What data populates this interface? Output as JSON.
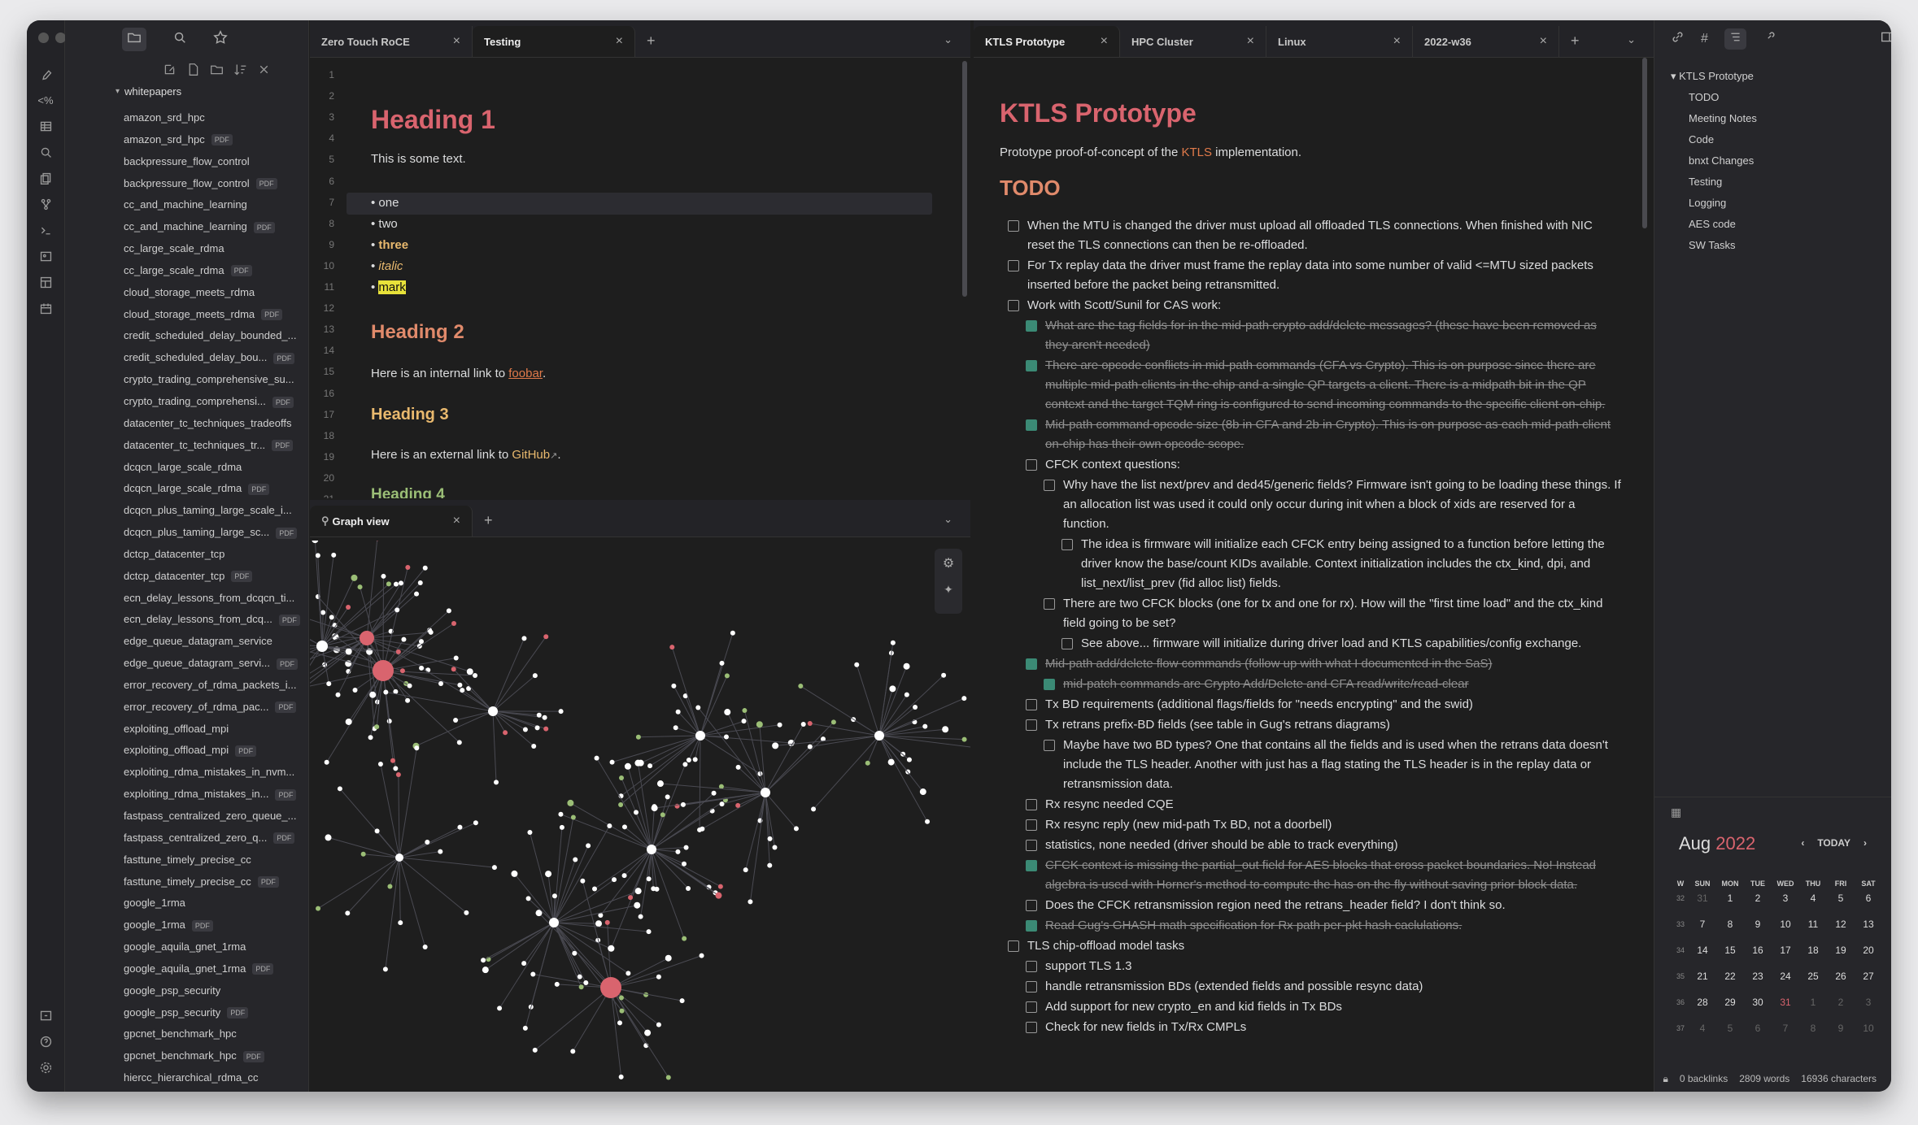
{
  "sidebar": {
    "folder": "whitepapers",
    "files": [
      {
        "n": "amazon_srd_hpc",
        "pdf": false
      },
      {
        "n": "amazon_srd_hpc",
        "pdf": true
      },
      {
        "n": "backpressure_flow_control",
        "pdf": false
      },
      {
        "n": "backpressure_flow_control",
        "pdf": true
      },
      {
        "n": "cc_and_machine_learning",
        "pdf": false
      },
      {
        "n": "cc_and_machine_learning",
        "pdf": true
      },
      {
        "n": "cc_large_scale_rdma",
        "pdf": false
      },
      {
        "n": "cc_large_scale_rdma",
        "pdf": true
      },
      {
        "n": "cloud_storage_meets_rdma",
        "pdf": false
      },
      {
        "n": "cloud_storage_meets_rdma",
        "pdf": true
      },
      {
        "n": "credit_scheduled_delay_bounded_...",
        "pdf": false
      },
      {
        "n": "credit_scheduled_delay_bou...",
        "pdf": true
      },
      {
        "n": "crypto_trading_comprehensive_su...",
        "pdf": false
      },
      {
        "n": "crypto_trading_comprehensi...",
        "pdf": true
      },
      {
        "n": "datacenter_tc_techniques_tradeoffs",
        "pdf": false
      },
      {
        "n": "datacenter_tc_techniques_tr...",
        "pdf": true
      },
      {
        "n": "dcqcn_large_scale_rdma",
        "pdf": false
      },
      {
        "n": "dcqcn_large_scale_rdma",
        "pdf": true
      },
      {
        "n": "dcqcn_plus_taming_large_scale_i...",
        "pdf": false
      },
      {
        "n": "dcqcn_plus_taming_large_sc...",
        "pdf": true
      },
      {
        "n": "dctcp_datacenter_tcp",
        "pdf": false
      },
      {
        "n": "dctcp_datacenter_tcp",
        "pdf": true
      },
      {
        "n": "ecn_delay_lessons_from_dcqcn_ti...",
        "pdf": false
      },
      {
        "n": "ecn_delay_lessons_from_dcq...",
        "pdf": true
      },
      {
        "n": "edge_queue_datagram_service",
        "pdf": false
      },
      {
        "n": "edge_queue_datagram_servi...",
        "pdf": true
      },
      {
        "n": "error_recovery_of_rdma_packets_i...",
        "pdf": false
      },
      {
        "n": "error_recovery_of_rdma_pac...",
        "pdf": true
      },
      {
        "n": "exploiting_offload_mpi",
        "pdf": false
      },
      {
        "n": "exploiting_offload_mpi",
        "pdf": true
      },
      {
        "n": "exploiting_rdma_mistakes_in_nvm...",
        "pdf": false
      },
      {
        "n": "exploiting_rdma_mistakes_in...",
        "pdf": true
      },
      {
        "n": "fastpass_centralized_zero_queue_...",
        "pdf": false
      },
      {
        "n": "fastpass_centralized_zero_q...",
        "pdf": true
      },
      {
        "n": "fasttune_timely_precise_cc",
        "pdf": false
      },
      {
        "n": "fasttune_timely_precise_cc",
        "pdf": true
      },
      {
        "n": "google_1rma",
        "pdf": false
      },
      {
        "n": "google_1rma",
        "pdf": true
      },
      {
        "n": "google_aquila_gnet_1rma",
        "pdf": false
      },
      {
        "n": "google_aquila_gnet_1rma",
        "pdf": true
      },
      {
        "n": "google_psp_security",
        "pdf": false
      },
      {
        "n": "google_psp_security",
        "pdf": true
      },
      {
        "n": "gpcnet_benchmark_hpc",
        "pdf": false
      },
      {
        "n": "gpcnet_benchmark_hpc",
        "pdf": true
      },
      {
        "n": "hiercc_hierarchical_rdma_cc",
        "pdf": false
      }
    ],
    "pdf_badge": "PDF"
  },
  "left_tabs": [
    {
      "label": "Zero Touch RoCE",
      "active": false
    },
    {
      "label": "Testing",
      "active": true
    }
  ],
  "right_tabs": [
    {
      "label": "KTLS Prototype",
      "active": true
    },
    {
      "label": "HPC Cluster",
      "active": false
    },
    {
      "label": "Linux",
      "active": false
    },
    {
      "label": "2022-w36",
      "active": false
    }
  ],
  "graph_tab": "Graph view",
  "editor": {
    "h1": "Heading 1",
    "text1": "This is some text.",
    "b1": "one",
    "b2": "two",
    "b3": "three",
    "b4": "italic",
    "b5": "mark",
    "h2": "Heading 2",
    "int_pre": "Here is an internal link to ",
    "int_link": "foobar",
    "int_post": ".",
    "h3": "Heading 3",
    "ext_pre": "Here is an external link to ",
    "ext_link": "GitHub",
    "ext_post": ".",
    "h4": "Heading 4"
  },
  "reading": {
    "title": "KTLS Prototype",
    "sub_pre": "Prototype proof-of-concept of the ",
    "sub_link": "KTLS",
    "sub_post": " implementation.",
    "todo": "TODO",
    "tasks": [
      {
        "d": 0,
        "done": false,
        "t": "When the MTU is changed the driver must upload all offloaded TLS connections. When finished with NIC reset the TLS connections can then be re-offloaded."
      },
      {
        "d": 0,
        "done": false,
        "t": "For Tx replay data the driver must frame the replay data into some number of valid <=MTU sized packets inserted before the packet being retransmitted."
      },
      {
        "d": 0,
        "done": false,
        "t": "Work with Scott/Sunil for CAS work:"
      },
      {
        "d": 1,
        "done": true,
        "t": "What are the tag fields for in the mid-path crypto add/delete messages? (these have been removed as they aren't needed)"
      },
      {
        "d": 1,
        "done": true,
        "t": "There are opcode conflicts in mid-path commands (CFA vs Crypto). This is on purpose since there are multiple mid-path clients in the chip and a single QP targets a client. There is a midpath bit in the QP context and the target TQM ring is configured to send incoming commands to the specific client on-chip."
      },
      {
        "d": 1,
        "done": true,
        "t": "Mid-path command opcode size (8b in CFA and 2b in Crypto). This is on purpose as each mid-path client on-chip has their own opcode scope."
      },
      {
        "d": 1,
        "done": false,
        "t": "CFCK context questions:"
      },
      {
        "d": 2,
        "done": false,
        "t": "Why have the list next/prev and ded45/generic fields? Firmware isn't going to be loading these things. If an allocation list was used it could only occur during init when a block of xids are reserved for a function."
      },
      {
        "d": 3,
        "done": false,
        "t": "The idea is firmware will initialize each CFCK entry being assigned to a function before letting the driver know the base/count KIDs available. Context initialization includes the ctx_kind, dpi, and list_next/list_prev (fid alloc list) fields."
      },
      {
        "d": 2,
        "done": false,
        "t": "There are two CFCK blocks (one for tx and one for rx). How will the \"first time load\" and the ctx_kind field going to be set?"
      },
      {
        "d": 3,
        "done": false,
        "t": "See above... firmware will initialize during driver load and KTLS capabilities/config exchange."
      },
      {
        "d": 1,
        "done": true,
        "t": "Mid-path add/delete flow commands (follow up with what I documented in the SaS)"
      },
      {
        "d": 2,
        "done": true,
        "t": "mid-patch commands are Crypto Add/Delete and CFA read/write/read-clear"
      },
      {
        "d": 1,
        "done": false,
        "t": "Tx BD requirements (additional flags/fields for \"needs encrypting\" and the swid)"
      },
      {
        "d": 1,
        "done": false,
        "t": "Tx retrans prefix-BD fields (see table in Gug's retrans diagrams)"
      },
      {
        "d": 2,
        "done": false,
        "t": "Maybe have two BD types? One that contains all the fields and is used when the retrans data doesn't include the TLS header. Another with just has a flag stating the TLS header is in the replay data or retransmission data."
      },
      {
        "d": 1,
        "done": false,
        "t": "Rx resync needed CQE"
      },
      {
        "d": 1,
        "done": false,
        "t": "Rx resync reply (new mid-path Tx BD, not a doorbell)"
      },
      {
        "d": 1,
        "done": false,
        "t": "statistics, none needed (driver should be able to track everything)"
      },
      {
        "d": 1,
        "done": true,
        "t": "CFCK context is missing the partial_out field for AES blocks that cross packet boundaries. No! Instead algebra is used with Horner's method to compute the has on the fly without saving prior block data."
      },
      {
        "d": 1,
        "done": false,
        "t": "Does the CFCK retransmission region need the retrans_header field? I don't think so."
      },
      {
        "d": 1,
        "done": true,
        "t": "Read Gug's GHASH math specification for Rx path per-pkt hash caclulations."
      },
      {
        "d": 0,
        "done": false,
        "t": "TLS chip-offload model tasks"
      },
      {
        "d": 1,
        "done": false,
        "t": "support TLS 1.3"
      },
      {
        "d": 1,
        "done": false,
        "t": "handle retransmission BDs (extended fields and possible resync data)"
      },
      {
        "d": 1,
        "done": false,
        "t": "Add support for new crypto_en and kid fields in Tx BDs"
      },
      {
        "d": 1,
        "done": false,
        "t": "Check for new fields in Tx/Rx CMPLs"
      }
    ]
  },
  "outline": [
    "KTLS Prototype",
    "TODO",
    "Meeting Notes",
    "Code",
    "bnxt Changes",
    "Testing",
    "Logging",
    "AES code",
    "SW Tasks"
  ],
  "calendar": {
    "month": "Aug",
    "year": "2022",
    "today_label": "TODAY",
    "headers": [
      "W",
      "SUN",
      "MON",
      "TUE",
      "WED",
      "THU",
      "FRI",
      "SAT"
    ],
    "weeks": [
      [
        "32",
        "31",
        "1",
        "2",
        "3",
        "4",
        "5",
        "6"
      ],
      [
        "33",
        "7",
        "8",
        "9",
        "10",
        "11",
        "12",
        "13"
      ],
      [
        "34",
        "14",
        "15",
        "16",
        "17",
        "18",
        "19",
        "20"
      ],
      [
        "35",
        "21",
        "22",
        "23",
        "24",
        "25",
        "26",
        "27"
      ],
      [
        "36",
        "28",
        "29",
        "30",
        "31",
        "1",
        "2",
        "3"
      ],
      [
        "37",
        "4",
        "5",
        "6",
        "7",
        "8",
        "9",
        "10"
      ]
    ]
  },
  "status": {
    "backlinks": "0 backlinks",
    "words": "2809 words",
    "chars": "16936 characters"
  },
  "colors": {
    "accent": "#d9646e",
    "h2": "#e08a6b",
    "h3": "#e9b96e",
    "h4": "#9bbe76",
    "done": "#3b8a75"
  }
}
